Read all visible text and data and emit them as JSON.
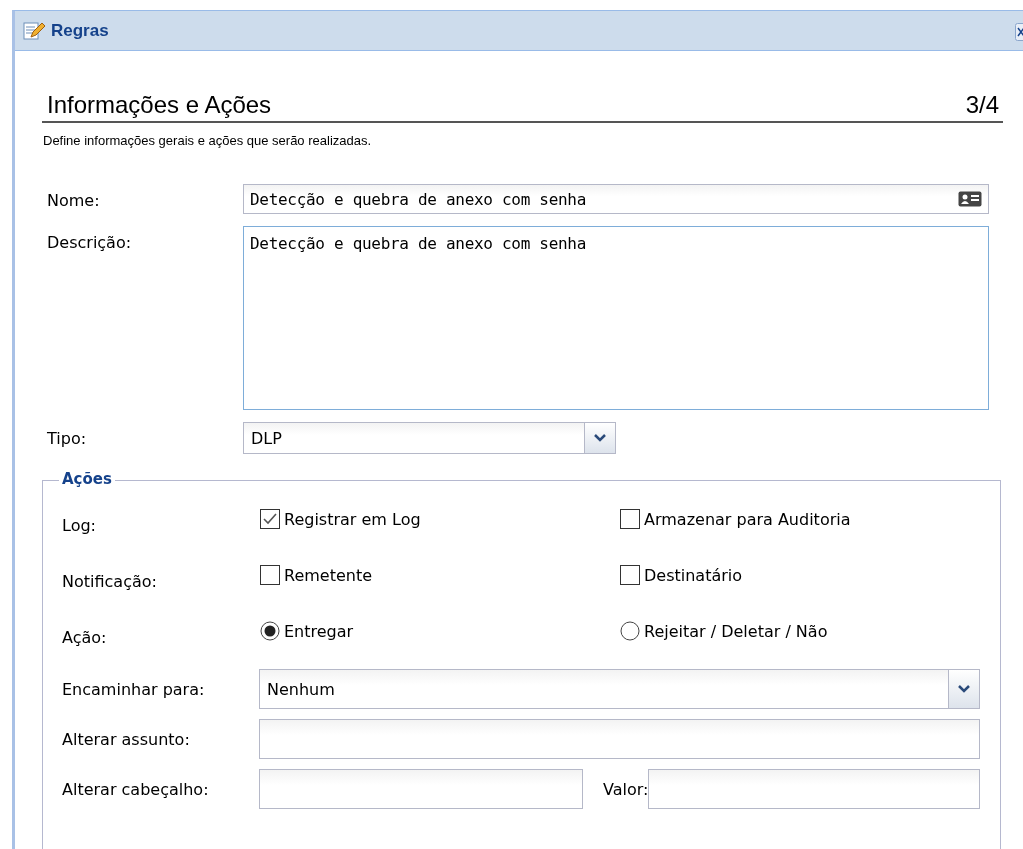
{
  "window": {
    "title": "Regras"
  },
  "header": {
    "title": "Informações e Ações",
    "step": "3/4",
    "description": "Define informações gerais e ações que serão realizadas."
  },
  "fields": [
    {
      "kind": "text",
      "label": "Nome:",
      "value": "Detecção e quebra de anexo com senha"
    },
    {
      "kind": "textarea",
      "label": "Descrição:",
      "value": "Detecção e quebra de anexo com senha"
    },
    {
      "kind": "select",
      "label": "Tipo:",
      "value": "DLP"
    }
  ],
  "actions": {
    "legend": "Ações",
    "rows": [
      {
        "label": "Log:",
        "options": [
          {
            "kind": "checkbox",
            "label": "Registrar em Log",
            "checked": true
          },
          {
            "kind": "checkbox",
            "label": "Armazenar para Auditoria",
            "checked": false
          }
        ]
      },
      {
        "label": "Notificação:",
        "options": [
          {
            "kind": "checkbox",
            "label": "Remetente",
            "checked": false
          },
          {
            "kind": "checkbox",
            "label": "Destinatário",
            "checked": false
          }
        ]
      },
      {
        "label": "Ação:",
        "options": [
          {
            "kind": "radio",
            "label": "Entregar",
            "selected": true
          },
          {
            "kind": "radio",
            "label": "Rejeitar / Deletar / Não",
            "selected": false
          }
        ]
      }
    ],
    "fields": [
      {
        "kind": "select",
        "label": "Encaminhar para:",
        "value": "Nenhum"
      },
      {
        "kind": "text",
        "label": "Alterar assunto:"
      },
      {
        "kind": "pair",
        "label": "Alterar cabeçalho:",
        "label_2": "Valor:"
      }
    ]
  }
}
